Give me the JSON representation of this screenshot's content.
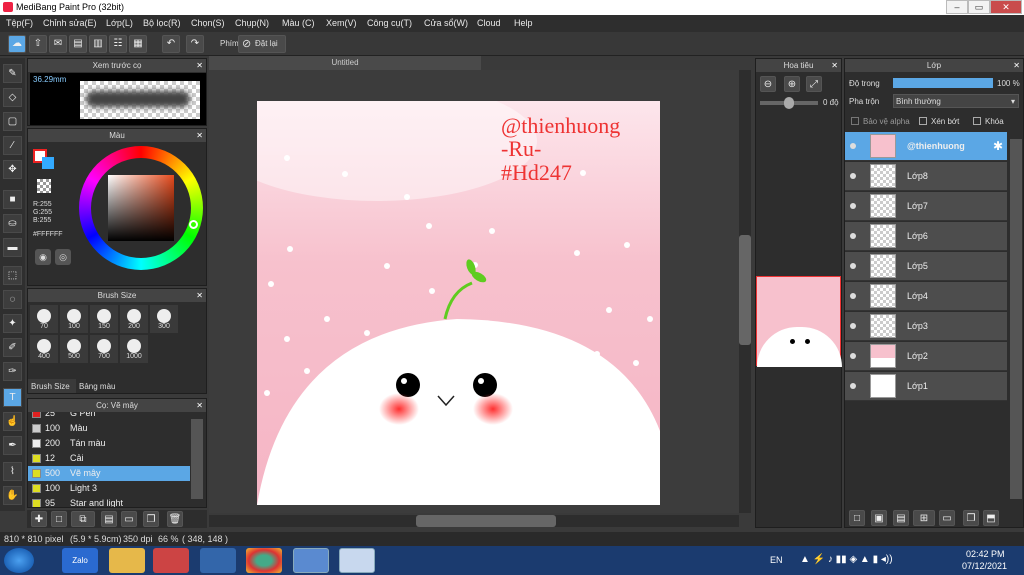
{
  "app": {
    "title": "MediBang Paint Pro (32bit)"
  },
  "menu": [
    "Tệp(F)",
    "Chỉnh sửa(E)",
    "Lớp(L)",
    "Bộ lọc(R)",
    "Chọn(S)",
    "Chụp(N)",
    "Màu (C)",
    "Xem(V)",
    "Công cụ(T)",
    "Cửa sổ(W)",
    "Cloud",
    "Help"
  ],
  "toolbar": {
    "phim_label": "Phím",
    "reset_label": "Đặt lại"
  },
  "panels": {
    "preview": {
      "title": "Xem trước cọ",
      "size": "36.29mm"
    },
    "color": {
      "title": "Màu",
      "r": "R:255",
      "g": "G:255",
      "b": "B:255",
      "hex": "#FFFFFF"
    },
    "brush_size": {
      "title": "Brush Size",
      "sizes": [
        "70",
        "100",
        "150",
        "200",
        "300",
        "400",
        "500",
        "700",
        "1000"
      ],
      "tab1": "Brush Size",
      "tab2": "Bảng màu"
    },
    "brush": {
      "title": "Cọ: Vẽ mây",
      "items": [
        {
          "size": "25",
          "name": "G Pen",
          "color": "#e02020"
        },
        {
          "size": "100",
          "name": "Màu",
          "color": "#cccccc"
        },
        {
          "size": "200",
          "name": "Tán màu",
          "color": "#eeeeee"
        },
        {
          "size": "12",
          "name": "Cải",
          "color": "#dddd22"
        },
        {
          "size": "500",
          "name": "Vẽ mây",
          "color": "#dddd22"
        },
        {
          "size": "100",
          "name": "Light 3",
          "color": "#dddd22"
        },
        {
          "size": "95",
          "name": "Star and light",
          "color": "#dddd22"
        }
      ]
    },
    "navigator": {
      "title": "Hoa tiêu",
      "angle": "0 độ"
    },
    "layers": {
      "title": "Lớp",
      "opacity_label": "Độ trong",
      "opacity_value": "100 %",
      "blend_label": "Pha trộn",
      "blend_value": "Bình thường",
      "protect_alpha": "Bảo vệ alpha",
      "clip": "Xén bớt",
      "lock": "Khóa",
      "items": [
        "@thienhuong",
        "Lớp8",
        "Lớp7",
        "Lớp6",
        "Lớp5",
        "Lớp4",
        "Lớp3",
        "Lớp2",
        "Lớp1"
      ]
    }
  },
  "canvas": {
    "tab": "Untitled",
    "text1": "@thienhuong",
    "text2": "-Ru-",
    "text3": "#Hd247"
  },
  "status": {
    "size": "810 * 810 pixel",
    "cm": "(5.9 * 5.9cm)",
    "dpi": "350 dpi",
    "zoom": "66 %",
    "pos": "( 348, 148 )"
  },
  "taskbar": {
    "lang": "EN",
    "time": "02:42 PM",
    "date": "07/12/2021",
    "zalo": "Zalo"
  },
  "colors": {
    "accent": "#5ba7e5",
    "pink": "#f7c6d0",
    "cheek": "#ff4444",
    "sprout": "#5fcc1f"
  }
}
